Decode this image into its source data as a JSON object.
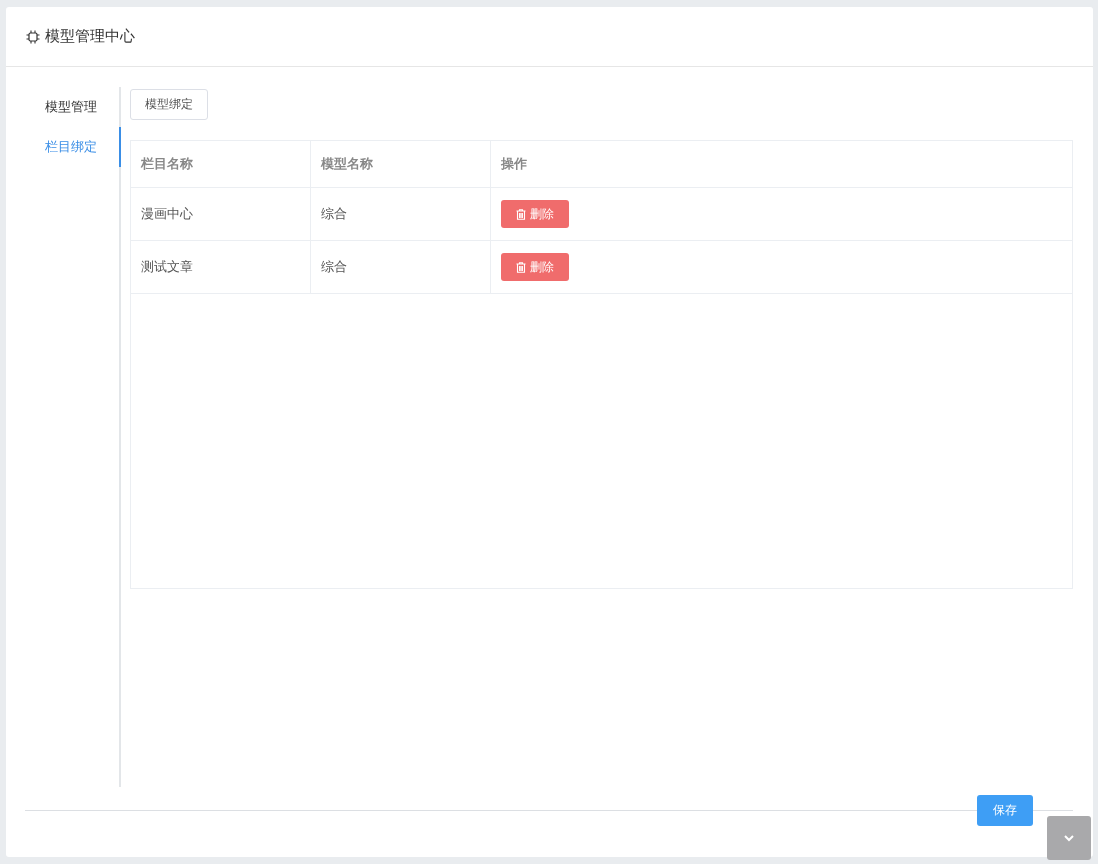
{
  "header": {
    "title": "模型管理中心"
  },
  "sidebar": {
    "items": [
      {
        "label": "模型管理",
        "selected": false
      },
      {
        "label": "栏目绑定",
        "selected": true
      }
    ]
  },
  "toolbar": {
    "button": "模型绑定"
  },
  "table": {
    "columns": [
      "栏目名称",
      "模型名称",
      "操作"
    ],
    "rows": [
      {
        "category": "漫画中心",
        "model": "综合",
        "action": "删除"
      },
      {
        "category": "测试文章",
        "model": "综合",
        "action": "删除"
      }
    ]
  },
  "footer": {
    "save_button": "保存"
  }
}
